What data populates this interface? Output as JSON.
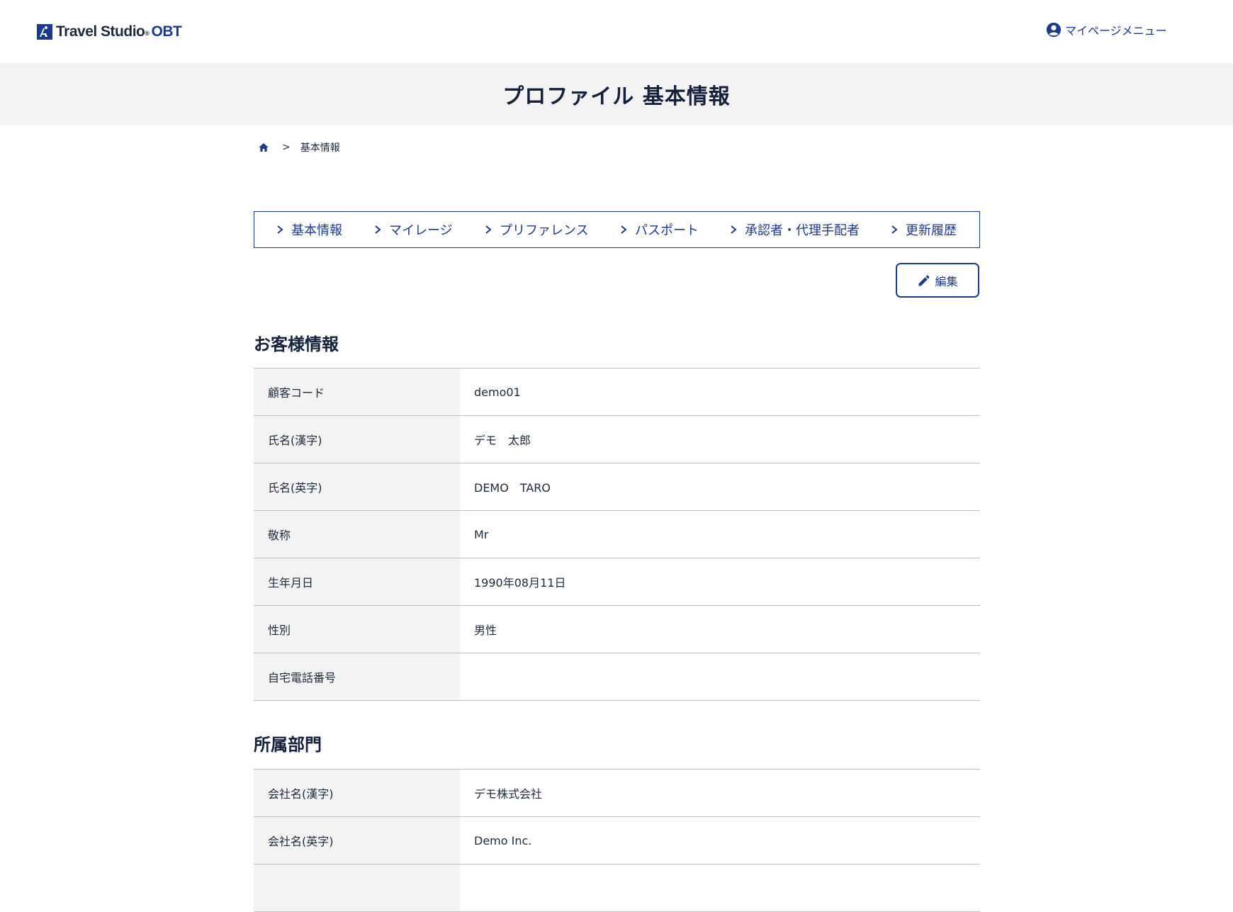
{
  "header": {
    "logo_text": "Travel Studio",
    "logo_reg": "®",
    "logo_obt": "OBT",
    "mypage_label": "マイページメニュー"
  },
  "title": "プロファイル 基本情報",
  "breadcrumb": {
    "separator": ">",
    "current": "基本情報"
  },
  "subnav": [
    {
      "label": "基本情報"
    },
    {
      "label": "マイレージ"
    },
    {
      "label": "プリファレンス"
    },
    {
      "label": "パスポート"
    },
    {
      "label": "承認者・代理手配者"
    },
    {
      "label": "更新履歴"
    }
  ],
  "edit_label": "編集",
  "sections": {
    "customer": {
      "title": "お客様情報",
      "rows": [
        {
          "label": "顧客コード",
          "value": "demo01"
        },
        {
          "label": "氏名(漢字)",
          "value": "デモ　太郎"
        },
        {
          "label": "氏名(英字)",
          "value": "DEMO　TARO"
        },
        {
          "label": "敬称",
          "value": "Mr"
        },
        {
          "label": "生年月日",
          "value": "1990年08月11日"
        },
        {
          "label": "性別",
          "value": "男性"
        },
        {
          "label": "自宅電話番号",
          "value": ""
        }
      ]
    },
    "department": {
      "title": "所属部門",
      "rows": [
        {
          "label": "会社名(漢字)",
          "value": "デモ株式会社"
        },
        {
          "label": "会社名(英字)",
          "value": "Demo Inc."
        }
      ]
    }
  },
  "colors": {
    "brand": "#1a3a8f",
    "band": "#f3f3f3",
    "text": "#1d2a3f",
    "border": "#bfbfbf"
  },
  "icons": [
    "logo-mark-icon",
    "user-circle-icon",
    "home-icon",
    "chevron-right-icon",
    "pencil-icon"
  ]
}
